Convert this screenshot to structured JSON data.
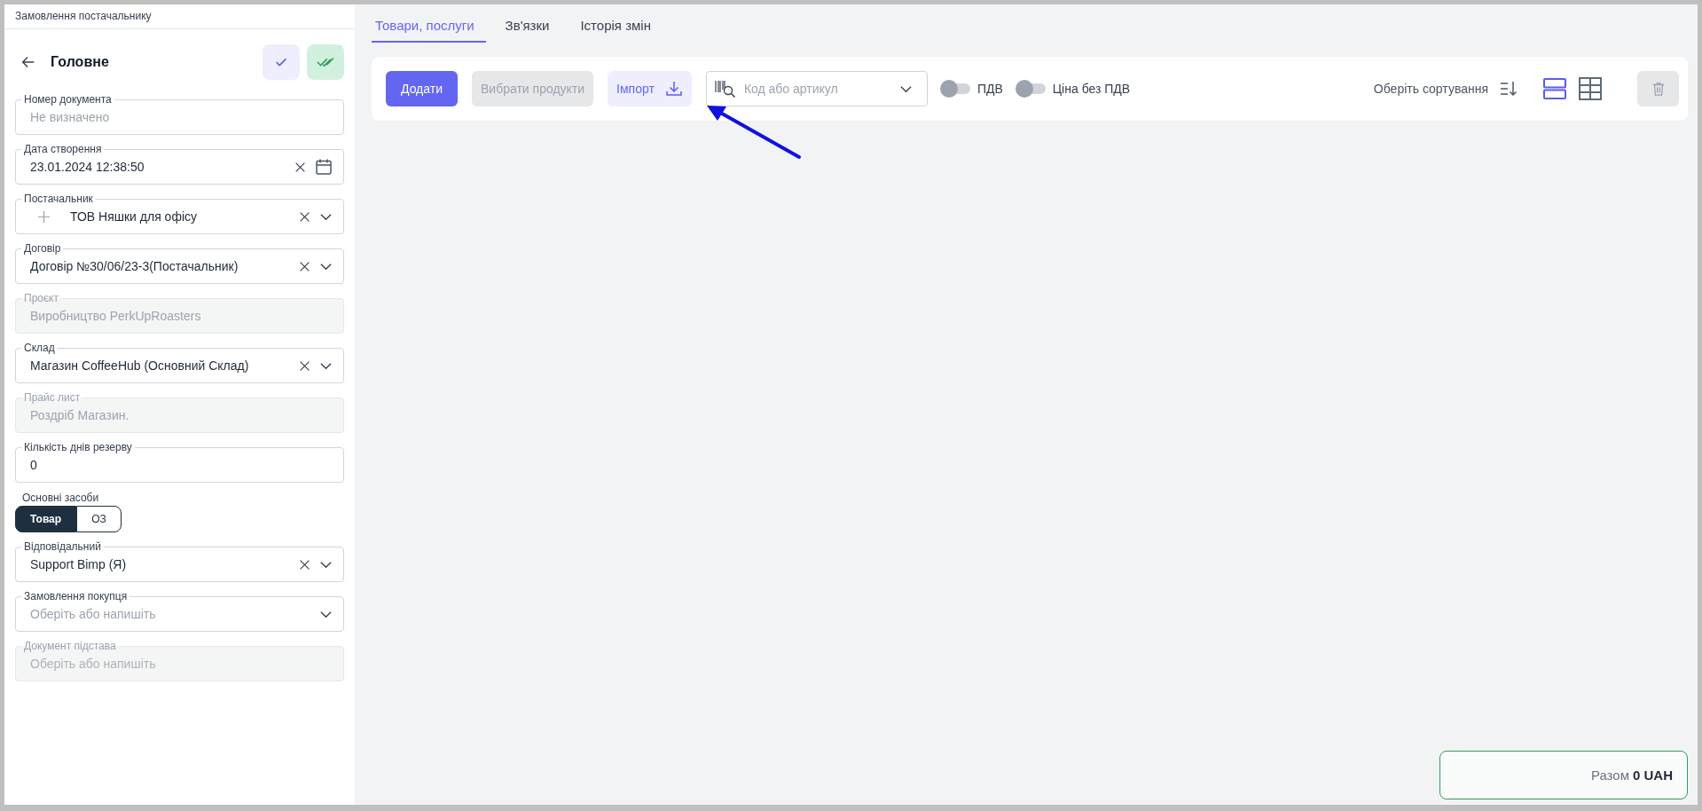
{
  "breadcrumb": "Замовлення постачальнику",
  "section": {
    "title": "Головне"
  },
  "header_actions": [
    {
      "kind": "check"
    },
    {
      "kind": "double-check"
    }
  ],
  "fields": [
    {
      "kind": "input",
      "label": "Номер документа",
      "placeholder": "Не визначено"
    },
    {
      "kind": "date",
      "label": "Дата створення",
      "value": "23.01.2024 12:38:50"
    },
    {
      "kind": "select",
      "label": "Постачальник",
      "value": "ТОВ Няшки для офісу",
      "add": true,
      "clearable": true
    },
    {
      "kind": "select",
      "label": "Договір",
      "value": "Договір №30/06/23-3(Постачальник)",
      "clearable": true
    },
    {
      "kind": "disabled",
      "label": "Проєкт",
      "value": "Виробництво PerkUpRoasters"
    },
    {
      "kind": "select",
      "label": "Склад",
      "value": "Магазин CoffeeHub (Основний Склад)",
      "clearable": true
    },
    {
      "kind": "disabled",
      "label": "Прайс лист",
      "value": "Роздріб Магазин."
    },
    {
      "kind": "input",
      "label": "Кількість днів резерву",
      "value": "0"
    },
    {
      "kind": "segmented",
      "label": "Основні засоби",
      "options": [
        {
          "label": "Товар",
          "selected": true
        },
        {
          "label": "ОЗ",
          "selected": false
        }
      ]
    },
    {
      "kind": "select",
      "label": "Відповідальний",
      "value": "Support Bimp (Я)",
      "clearable": true
    },
    {
      "kind": "select",
      "label": "Замовлення покупця",
      "placeholder": "Оберіть або напишіть",
      "clearable": false
    },
    {
      "kind": "disabled",
      "label": "Документ підстава",
      "placeholder": "Оберіть або напишіть"
    }
  ],
  "tabs": [
    {
      "label": "Товари, послуги",
      "selected": true
    },
    {
      "label": "Зв'язки",
      "selected": false
    },
    {
      "label": "Історія змін",
      "selected": false
    }
  ],
  "toolbar": {
    "add_button": "Додати",
    "select_products_button": "Вибрати продукти",
    "import_button": "Імпорт",
    "search": {
      "placeholder": "Код або артикул"
    },
    "toggles": [
      {
        "label": "ПДВ",
        "on": false
      },
      {
        "label": "Ціна без ПДВ",
        "on": false
      }
    ],
    "sort": "Оберіть сортування",
    "view_modes": [
      {
        "kind": "rows",
        "selected": true
      },
      {
        "kind": "grid",
        "selected": false
      }
    ]
  },
  "total": {
    "label": "Разом",
    "amount": "0 UAH"
  }
}
